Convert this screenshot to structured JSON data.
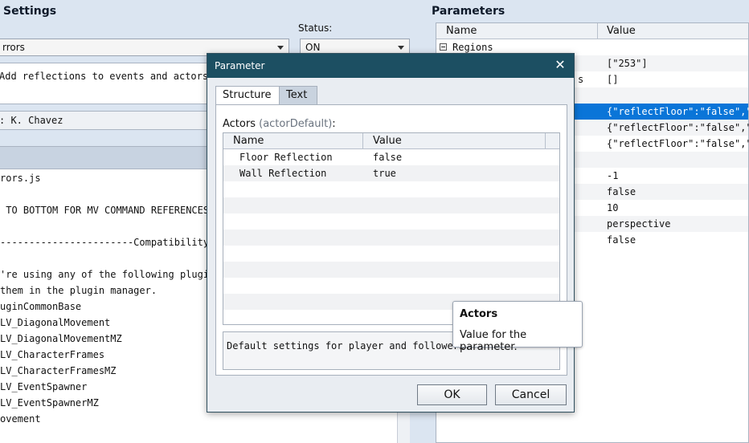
{
  "left": {
    "settings_title": "Settings",
    "plugin_name": "rrors",
    "status_label": "Status:",
    "status_value": "ON",
    "description": "Add reflections to events and actors.",
    "author": ": K. Chavez",
    "help_lines": [
      "rors.js",
      "",
      " TO BOTTOM FOR MV COMMAND REFERENCES",
      "",
      "-----------------------Compatibility No",
      "",
      "'re using any of the following plugins",
      "them in the plugin manager.",
      "uginCommonBase",
      "LV_DiagonalMovement",
      "LV_DiagonalMovementMZ",
      "LV_CharacterFrames",
      "LV_CharacterFramesMZ",
      "LV_EventSpawner",
      "LV_EventSpawnerMZ",
      "ovement"
    ]
  },
  "right": {
    "title": "Parameters",
    "col_name": "Name",
    "col_value": "Value",
    "rows": [
      {
        "name": "Regions",
        "value": ""
      },
      {
        "name": "",
        "value": "[\"253\"]"
      },
      {
        "name": "s",
        "value": "[]"
      },
      {
        "name": "",
        "value": ""
      },
      {
        "name": "",
        "value": "{\"reflectFloor\":\"false\",\"re"
      },
      {
        "name": "",
        "value": "{\"reflectFloor\":\"false\",\"re"
      },
      {
        "name": "",
        "value": "{\"reflectFloor\":\"false\",\"re"
      },
      {
        "name": "",
        "value": ""
      },
      {
        "name": "",
        "value": "-1"
      },
      {
        "name": "",
        "value": "false"
      },
      {
        "name": "",
        "value": "10"
      },
      {
        "name": "",
        "value": "perspective"
      },
      {
        "name": "",
        "value": "false"
      }
    ],
    "collapse_icon": "minus-box-icon"
  },
  "dialog": {
    "title": "Parameter",
    "close_glyph": "✕",
    "tab_structure": "Structure",
    "tab_text": "Text",
    "label_main": "Actors",
    "label_sub": "(actorDefault)",
    "label_colon": ":",
    "col_name": "Name",
    "col_value": "Value",
    "rows": [
      {
        "name": "Floor Reflection",
        "value": "false"
      },
      {
        "name": "Wall Reflection",
        "value": "true"
      }
    ],
    "description": "Default settings for player and followers.",
    "ok_label": "OK",
    "cancel_label": "Cancel"
  },
  "tooltip": {
    "title": "Actors",
    "body": "Value for the parameter."
  }
}
